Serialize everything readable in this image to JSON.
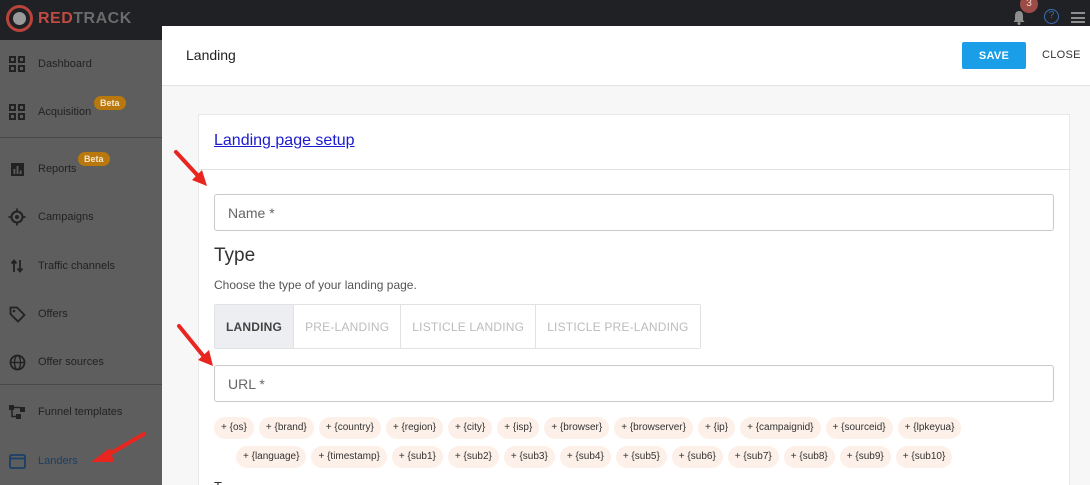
{
  "brand": {
    "part1": "RED",
    "part2": "TRACK"
  },
  "topbar": {
    "notifications_count": "3",
    "help": "?"
  },
  "sidebar": {
    "items": [
      {
        "label": "Dashboard",
        "icon": "dashboard-icon"
      },
      {
        "label": "Acquisition",
        "icon": "dashboard-icon",
        "badge": "Beta"
      },
      {
        "label": "Reports",
        "icon": "bar-chart-icon",
        "badge": "Beta"
      },
      {
        "label": "Campaigns",
        "icon": "target-icon"
      },
      {
        "label": "Traffic channels",
        "icon": "arrows-updown-icon"
      },
      {
        "label": "Offers",
        "icon": "tag-icon"
      },
      {
        "label": "Offer sources",
        "icon": "globe-icon"
      },
      {
        "label": "Funnel templates",
        "icon": "funnel-icon"
      },
      {
        "label": "Landers",
        "icon": "window-icon",
        "active": true
      }
    ]
  },
  "modal": {
    "title": "Landing",
    "save_label": "SAVE",
    "close_label": "CLOSE",
    "section_title": "Landing page setup",
    "name_placeholder": "Name *",
    "type_heading": "Type",
    "type_description": "Choose the type of your landing page.",
    "type_options": [
      "LANDING",
      "PRE-LANDING",
      "LISTICLE LANDING",
      "LISTICLE PRE-LANDING"
    ],
    "selected_type": "LANDING",
    "url_placeholder": "URL *",
    "tokens_row1": [
      "+ {os}",
      "+ {brand}",
      "+ {country}",
      "+ {region}",
      "+ {city}",
      "+ {isp}",
      "+ {browser}",
      "+ {browserver}",
      "+ {ip}",
      "+ {campaignid}",
      "+ {sourceid}",
      "+ {lpkeyua}"
    ],
    "tokens_row2": [
      "+ {language}",
      "+ {timestamp}",
      "+ {sub1}",
      "+ {sub2}",
      "+ {sub3}",
      "+ {sub4}",
      "+ {sub5}",
      "+ {sub6}",
      "+ {sub7}",
      "+ {sub8}",
      "+ {sub9}",
      "+ {sub10}"
    ],
    "truncated_text": "T"
  },
  "colors": {
    "accent": "#1a9ee8",
    "arrow": "#e8261f",
    "badge": "#b8780e"
  }
}
